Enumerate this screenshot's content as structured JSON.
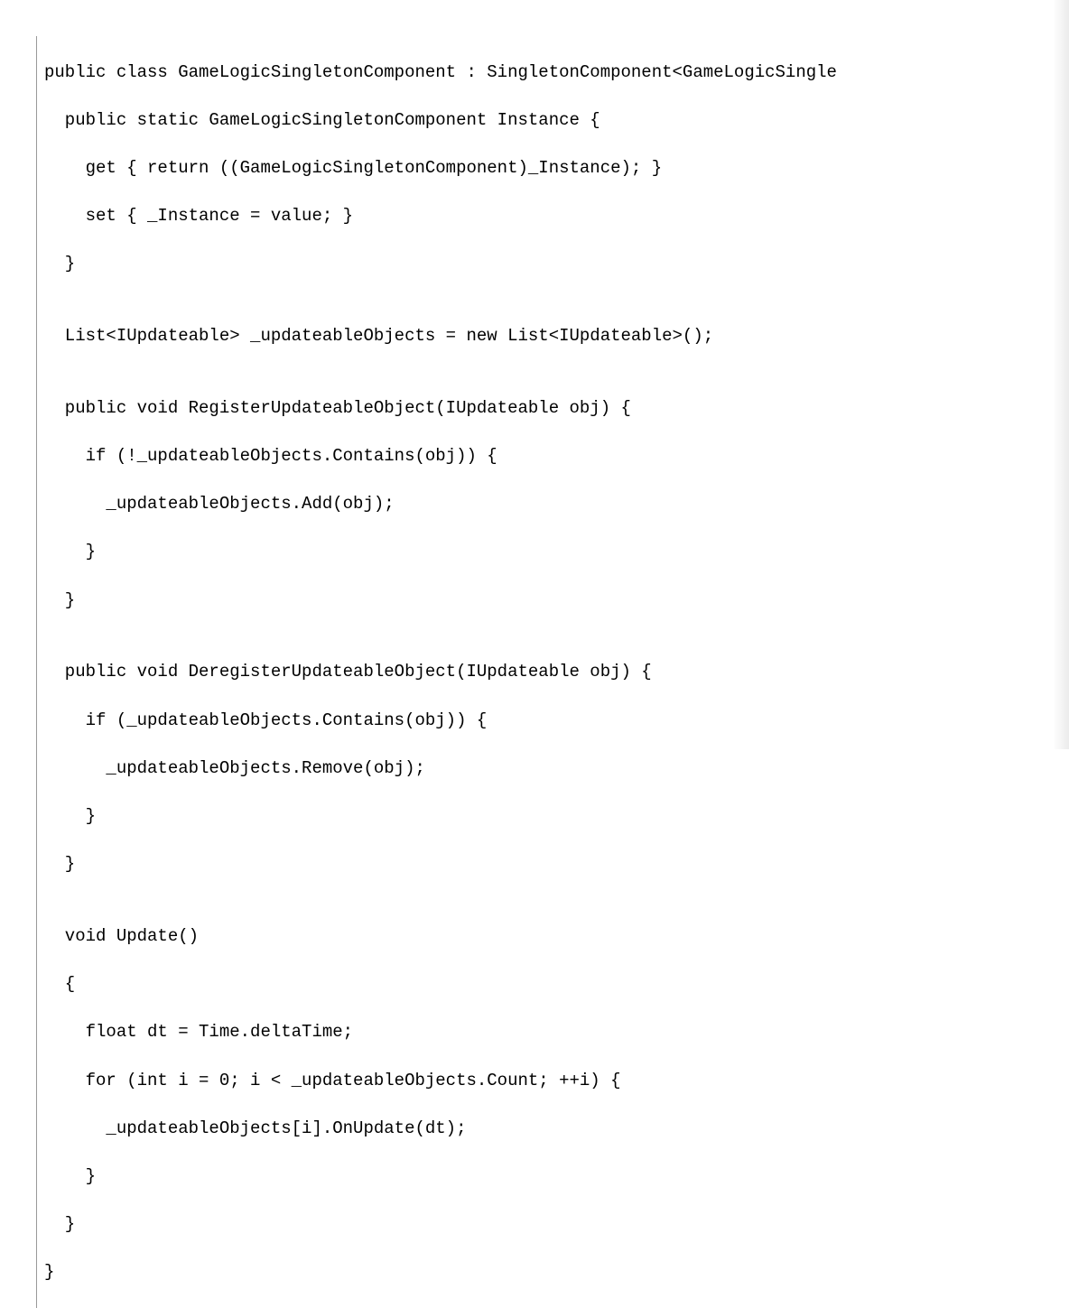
{
  "code": {
    "lines": [
      "public class GameLogicSingletonComponent : SingletonComponent<GameLogicSingle",
      "  public static GameLogicSingletonComponent Instance {",
      "    get { return ((GameLogicSingletonComponent)_Instance); }",
      "    set { _Instance = value; }",
      "  }",
      "",
      "  List<IUpdateable> _updateableObjects = new List<IUpdateable>();",
      "",
      "  public void RegisterUpdateableObject(IUpdateable obj) {",
      "    if (!_updateableObjects.Contains(obj)) {",
      "      _updateableObjects.Add(obj);",
      "    }",
      "  }",
      "",
      "  public void DeregisterUpdateableObject(IUpdateable obj) {",
      "    if (_updateableObjects.Contains(obj)) {",
      "      _updateableObjects.Remove(obj);",
      "    }",
      "  }",
      "",
      "  void Update()",
      "  {",
      "    float dt = Time.deltaTime;",
      "    for (int i = 0; i < _updateableObjects.Count; ++i) {",
      "      _updateableObjects[i].OnUpdate(dt);",
      "    }",
      "  }",
      "}"
    ]
  }
}
